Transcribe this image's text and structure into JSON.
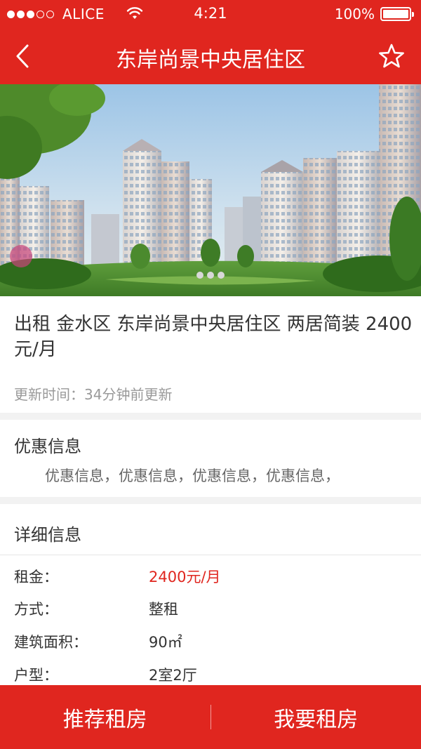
{
  "status_bar": {
    "carrier": "ALICE",
    "time": "4:21",
    "battery": "100%"
  },
  "nav": {
    "title": "东岸尚景中央居住区",
    "back_icon": "chevron-left-icon",
    "favorite_icon": "star-outline-icon"
  },
  "listing": {
    "title": "出租 金水区 东岸尚景中央居住区 两居简装 2400元/月",
    "update_time": "更新时间：34分钟前更新"
  },
  "discount": {
    "heading": "优惠信息",
    "text": "优惠信息，优惠信息，优惠信息，优惠信息，"
  },
  "details": {
    "heading": "详细信息",
    "rows": [
      {
        "label": "租金：",
        "value": "2400元/月"
      },
      {
        "label": "方式：",
        "value": "整租"
      },
      {
        "label": "建筑面积：",
        "value": "90㎡"
      },
      {
        "label": "户型：",
        "value": "2室2厅"
      }
    ]
  },
  "actions": {
    "recommend": "推荐租房",
    "rent": "我要租房"
  },
  "colors": {
    "brand_red": "#e0261f"
  }
}
